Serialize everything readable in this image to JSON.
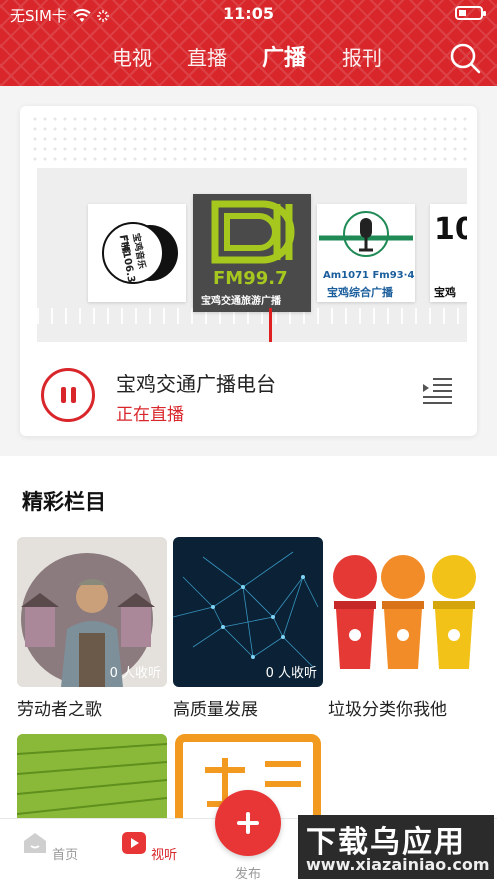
{
  "status_bar": {
    "carrier": "无SIM卡",
    "time": "11:05"
  },
  "nav": {
    "tabs": [
      "电视",
      "直播",
      "广播",
      "报刊"
    ],
    "active": "广播"
  },
  "player": {
    "stations": [
      {
        "label_top": "FM106.3",
        "label_sub": "宝鸡音乐广播"
      },
      {
        "label_top": "FM99.7",
        "label_sub": "宝鸡交通旅游广播"
      },
      {
        "label_top": "Am1071 Fm93·4",
        "label_sub": "宝鸡综合广播"
      },
      {
        "label_top": "10",
        "label_sub": "宝鸡"
      }
    ],
    "station_name": "宝鸡交通广播电台",
    "status": "正在直播"
  },
  "section": {
    "title": "精彩栏目",
    "items": [
      {
        "label": "劳动者之歌",
        "count": "0 人收听"
      },
      {
        "label": "高质量发展",
        "count": "0 人收听"
      },
      {
        "label": "垃圾分类你我他",
        "count": ""
      }
    ]
  },
  "tabbar": {
    "items": [
      "首页",
      "视听",
      "发布"
    ]
  },
  "watermark": {
    "line1": "下载乌应用",
    "line2": "www.xiazainiao.com"
  },
  "colors": {
    "brand_red": "#d8262b",
    "accent_yellow": "#a6c81e"
  }
}
